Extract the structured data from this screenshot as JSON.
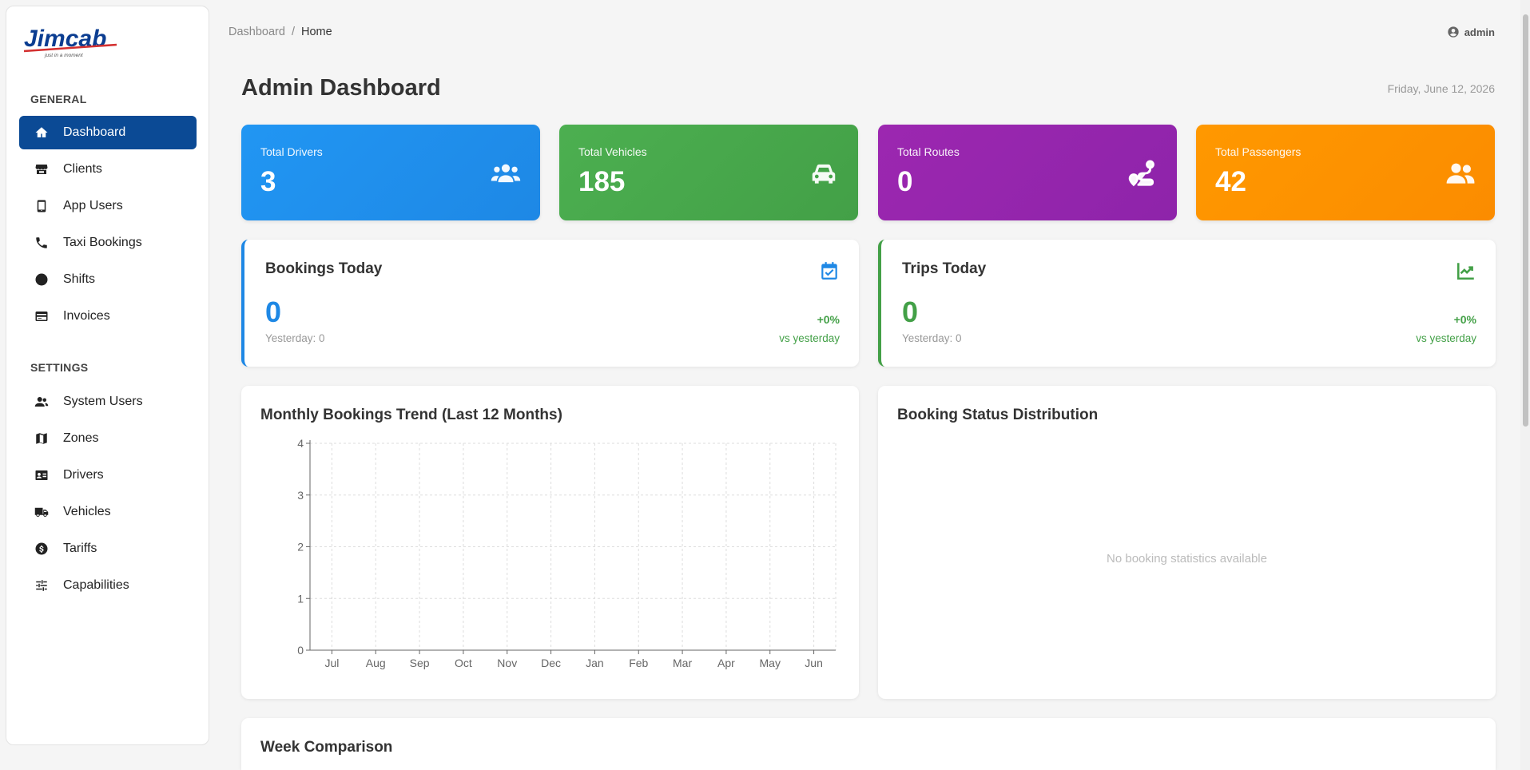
{
  "app": {
    "logo_text": "Jimcab",
    "logo_tagline": "just in a moment"
  },
  "sidebar": {
    "general_title": "GENERAL",
    "general_items": [
      {
        "label": "Dashboard",
        "icon": "home-icon",
        "active": true
      },
      {
        "label": "Clients",
        "icon": "store-icon"
      },
      {
        "label": "App Users",
        "icon": "mobile-icon"
      },
      {
        "label": "Taxi Bookings",
        "icon": "phone-icon"
      },
      {
        "label": "Shifts",
        "icon": "clock-icon"
      },
      {
        "label": "Invoices",
        "icon": "card-icon"
      }
    ],
    "settings_title": "SETTINGS",
    "settings_items": [
      {
        "label": "System Users",
        "icon": "users-icon"
      },
      {
        "label": "Zones",
        "icon": "map-icon"
      },
      {
        "label": "Drivers",
        "icon": "id-card-icon"
      },
      {
        "label": "Vehicles",
        "icon": "truck-icon"
      },
      {
        "label": "Tariffs",
        "icon": "dollar-icon"
      },
      {
        "label": "Capabilities",
        "icon": "sliders-icon"
      }
    ]
  },
  "header": {
    "breadcrumb_parent": "Dashboard",
    "breadcrumb_sep": "/",
    "breadcrumb_current": "Home",
    "user": "admin",
    "title": "Admin Dashboard",
    "date": "Friday, June 12, 2026"
  },
  "stats": [
    {
      "label": "Total Drivers",
      "value": "3",
      "color": "#1e88e5",
      "icon": "users-group-icon"
    },
    {
      "label": "Total Vehicles",
      "value": "185",
      "color": "#43a047",
      "icon": "car-icon"
    },
    {
      "label": "Total Routes",
      "value": "0",
      "color": "#9c27b0",
      "icon": "route-icon"
    },
    {
      "label": "Total Passengers",
      "value": "42",
      "color": "#fb8c00",
      "icon": "user-friends-icon"
    }
  ],
  "today": {
    "bookings": {
      "title": "Bookings Today",
      "value": "0",
      "yesterday": "Yesterday: 0",
      "pct": "+0%",
      "vs": "vs yesterday",
      "accent": "#1e88e5"
    },
    "trips": {
      "title": "Trips Today",
      "value": "0",
      "yesterday": "Yesterday: 0",
      "pct": "+0%",
      "vs": "vs yesterday",
      "accent": "#43a047"
    }
  },
  "trend_panel": {
    "title": "Monthly Bookings Trend (Last 12 Months)"
  },
  "status_panel": {
    "title": "Booking Status Distribution",
    "empty": "No booking statistics available"
  },
  "week_panel": {
    "title": "Week Comparison"
  },
  "chart_data": {
    "type": "line",
    "title": "Monthly Bookings Trend (Last 12 Months)",
    "categories": [
      "Jul",
      "Aug",
      "Sep",
      "Oct",
      "Nov",
      "Dec",
      "Jan",
      "Feb",
      "Mar",
      "Apr",
      "May",
      "Jun"
    ],
    "yticks": [
      "0",
      "1",
      "2",
      "3",
      "4"
    ],
    "ylim": [
      0,
      4
    ],
    "grid": true,
    "series": []
  }
}
